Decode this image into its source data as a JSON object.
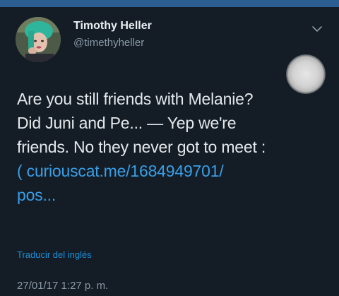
{
  "tweet": {
    "author": {
      "name": "Timothy Heller",
      "handle": "@timethyheller"
    },
    "text_lines": [
      "Are you still friends with Melanie?",
      "Did Juni and Pe... — Yep we're",
      "friends. No they never got to meet :"
    ],
    "link_lines": [
      "( curiouscat.me/1684949701/",
      "pos..."
    ],
    "translate_label": "Traducir del inglés",
    "timestamp": "27/01/17 1:27 p. m.",
    "icons": {
      "menu": "chevron-down-icon",
      "avatar": "profile-photo"
    },
    "colors": {
      "background": "#141d26",
      "top_strip": "#2c5e91",
      "link": "#3a9ee6",
      "secondary_text": "#8899a6"
    }
  }
}
